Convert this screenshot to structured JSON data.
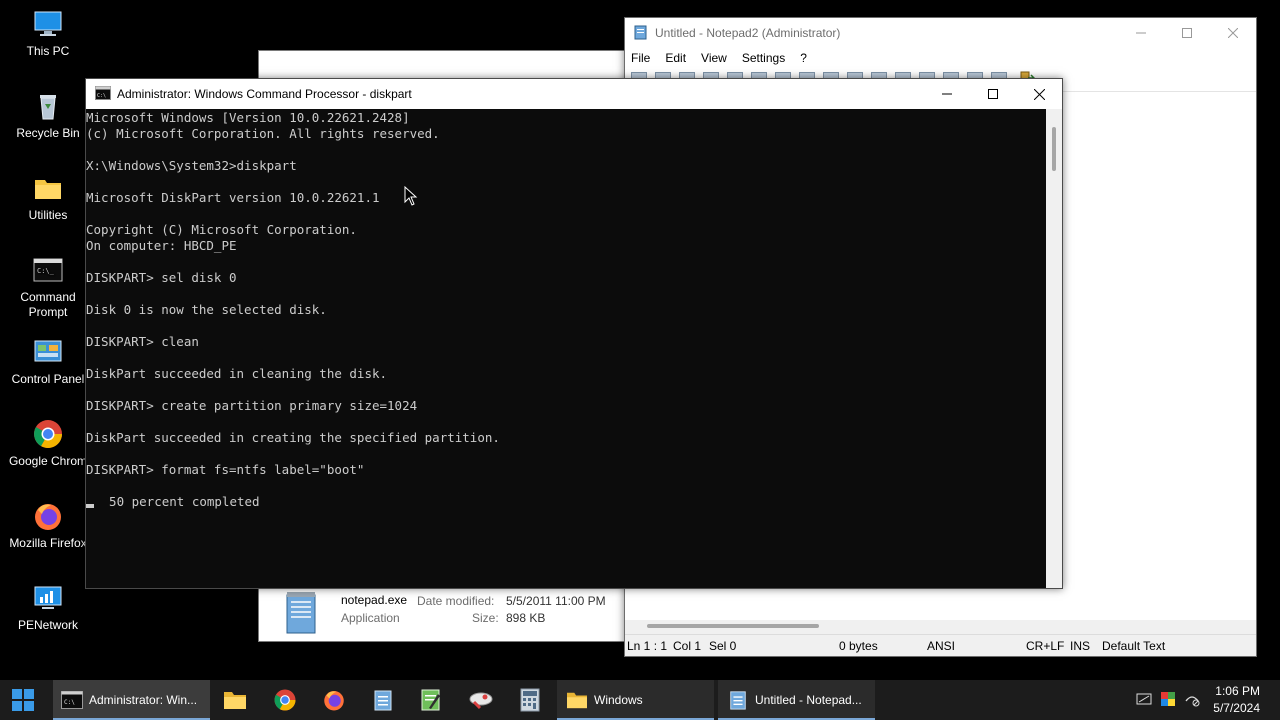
{
  "desktop": {
    "icons": [
      {
        "label": "This PC"
      },
      {
        "label": "Recycle Bin"
      },
      {
        "label": "Utilities"
      },
      {
        "label": "Command\nPrompt"
      },
      {
        "label": "Control Panel"
      },
      {
        "label": "Google Chrom"
      },
      {
        "label": "Mozilla Firefox"
      },
      {
        "label": "PENetwork"
      }
    ]
  },
  "explorer": {
    "file_name": "notepad.exe",
    "date_label": "Date modified:",
    "date_value": "5/5/2011 11:00 PM",
    "type": "Application",
    "size_label": "Size:",
    "size_value": "898 KB"
  },
  "notepad": {
    "title": "Untitled - Notepad2 (Administrator)",
    "menu": [
      "File",
      "Edit",
      "View",
      "Settings",
      "?"
    ],
    "status": {
      "position": "Ln 1 : 1",
      "col": "Col 1",
      "sel": "Sel 0",
      "bytes": "0 bytes",
      "encoding": "ANSI",
      "eol": "CR+LF",
      "ins": "INS",
      "scheme": "Default Text"
    }
  },
  "cmd": {
    "title": "Administrator: Windows Command Processor - diskpart",
    "lines": [
      "Microsoft Windows [Version 10.0.22621.2428]",
      "(c) Microsoft Corporation. All rights reserved.",
      "",
      "X:\\Windows\\System32>diskpart",
      "",
      "Microsoft DiskPart version 10.0.22621.1",
      "",
      "Copyright (C) Microsoft Corporation.",
      "On computer: HBCD_PE",
      "",
      "DISKPART> sel disk 0",
      "",
      "Disk 0 is now the selected disk.",
      "",
      "DISKPART> clean",
      "",
      "DiskPart succeeded in cleaning the disk.",
      "",
      "DISKPART> create partition primary size=1024",
      "",
      "DiskPart succeeded in creating the specified partition.",
      "",
      "DISKPART> format fs=ntfs label=\"boot\"",
      ""
    ],
    "progress_line": "  50 percent completed"
  },
  "taskbar": {
    "cmd_task": "Administrator: Win...",
    "explorer_task": "Windows",
    "notepad_task": "Untitled - Notepad...",
    "time": "1:06 PM",
    "date": "5/7/2024"
  },
  "colors": {
    "taskbar": "#1c1c1c",
    "console_bg": "#0c0c0c",
    "console_fg": "#cccccc",
    "accent": "#0078d7"
  }
}
